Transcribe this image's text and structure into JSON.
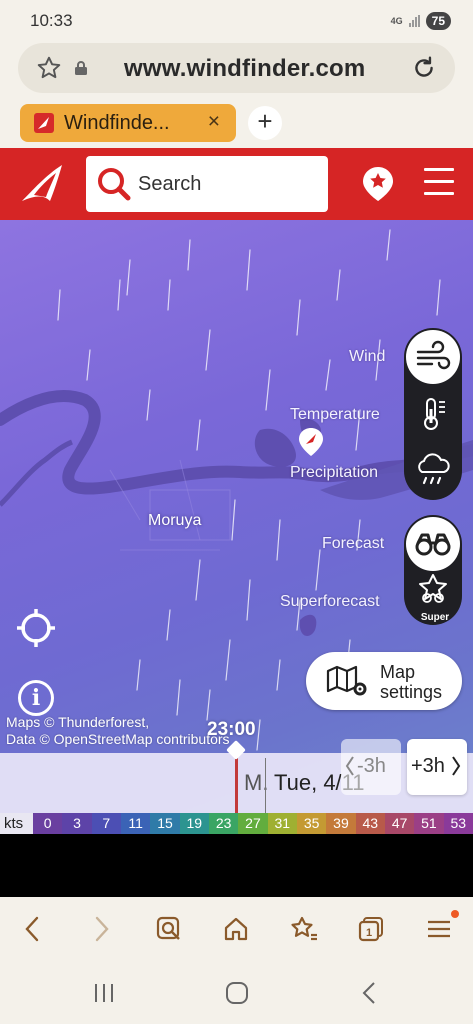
{
  "status": {
    "time": "10:33",
    "network": "4G",
    "battery": "75"
  },
  "browser": {
    "url": "www.windfinder.com",
    "tab_title": "Windfinde...",
    "tab_close": "×",
    "new_tab": "+"
  },
  "header": {
    "search_label": "Search"
  },
  "map": {
    "layers": {
      "wind": "Wind",
      "temperature": "Temperature",
      "precipitation": "Precipitation"
    },
    "forecasts": {
      "forecast": "Forecast",
      "superforecast": "Superforecast",
      "super_badge": "Super"
    },
    "places": {
      "moruya": "Moruya"
    },
    "map_settings_label": "Map settings",
    "info_glyph": "i",
    "attribution_line1": "Maps © Thunderforest,",
    "attribution_line2": "Data © OpenStreetMap contributors"
  },
  "timeline": {
    "current_time": "23:00",
    "prev_day": "M.",
    "current_day": "Tue, 4/11",
    "back_label": "-3h",
    "forward_label": "+3h"
  },
  "legend": {
    "unit": "kts",
    "stops": [
      {
        "value": "0",
        "color": "#6a3fa0"
      },
      {
        "value": "3",
        "color": "#5d43a8"
      },
      {
        "value": "7",
        "color": "#4c4fb4"
      },
      {
        "value": "11",
        "color": "#3b63b6"
      },
      {
        "value": "15",
        "color": "#2f7ba8"
      },
      {
        "value": "19",
        "color": "#2c9490"
      },
      {
        "value": "23",
        "color": "#3aa564"
      },
      {
        "value": "27",
        "color": "#62ad3e"
      },
      {
        "value": "31",
        "color": "#9fb032"
      },
      {
        "value": "35",
        "color": "#c49a33"
      },
      {
        "value": "39",
        "color": "#c47a3a"
      },
      {
        "value": "43",
        "color": "#b85a4a"
      },
      {
        "value": "47",
        "color": "#a84868"
      },
      {
        "value": "51",
        "color": "#9b3f86"
      },
      {
        "value": "53",
        "color": "#8a3a9a"
      }
    ]
  },
  "colors": {
    "brand_red": "#d62525",
    "tab_orange": "#efa93b",
    "toolbar_icon": "#8a5a2b"
  }
}
